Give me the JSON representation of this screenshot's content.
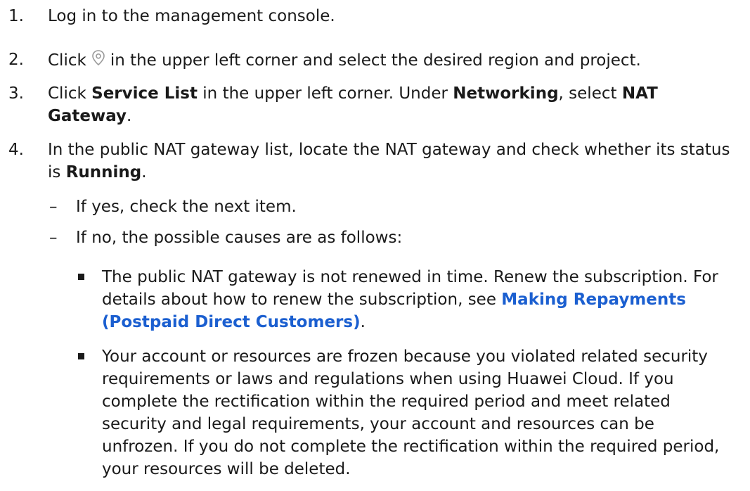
{
  "steps": [
    {
      "num": "1.",
      "text": "Log in to the management console."
    },
    {
      "num": "2.",
      "before_icon": "Click",
      "icon": "location-pin-icon",
      "after_icon": "in the upper left corner and select the desired region and project."
    },
    {
      "num": "3.",
      "p1": "Click ",
      "b1": "Service List",
      "p2": " in the upper left corner. Under ",
      "b2": "Networking",
      "p3": ", select ",
      "b3": "NAT Gateway",
      "p4": "."
    },
    {
      "num": "4.",
      "p1": "In the public NAT gateway list, locate the NAT gateway and check whether its status is ",
      "b1": "Running",
      "p2": ".",
      "sub_items": [
        {
          "marker": "–",
          "text": "If yes, check the next item."
        },
        {
          "marker": "–",
          "text": "If no, the possible causes are as follows:",
          "bullets": [
            {
              "text": "The public NAT gateway is not renewed in time. Renew the subscription. For details about how to renew the subscription, see ",
              "link": "Making Repayments (Postpaid Direct Customers)",
              "after": "."
            },
            {
              "text": "Your account or resources are frozen because you violated related security requirements or laws and regulations when using Huawei Cloud. If you complete the rectification within the required period and meet related security and legal requirements, your account and resources can be unfrozen. If you do not complete the rectification within the required period, your resources will be deleted."
            }
          ]
        }
      ]
    }
  ]
}
